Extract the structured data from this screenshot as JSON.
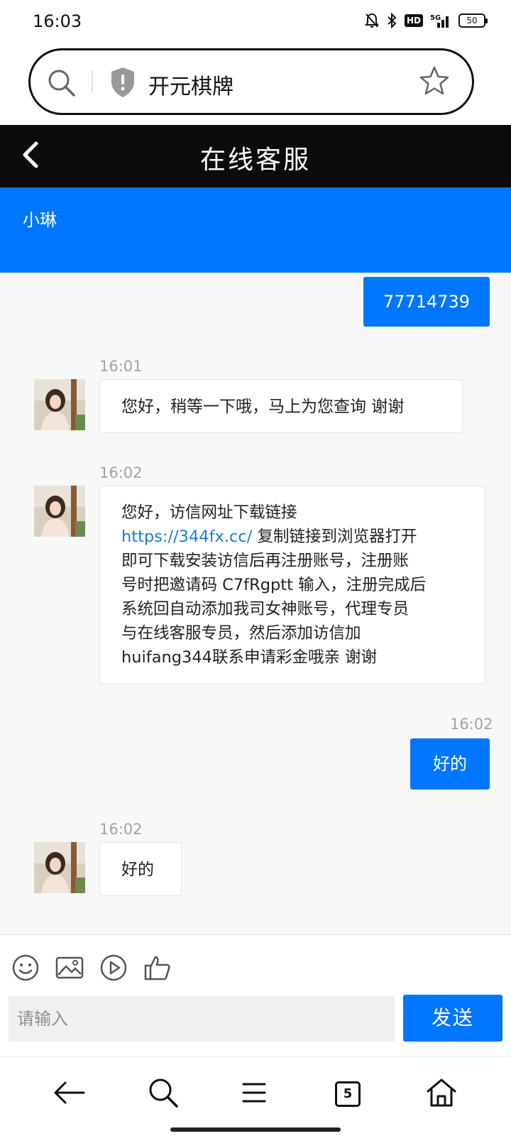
{
  "status_bar": {
    "time": "16:03",
    "network": "5G",
    "hd_label": "HD",
    "battery": "50",
    "icons": [
      "bell-off-icon",
      "bluetooth-icon",
      "hd-icon",
      "signal-icon",
      "battery-icon"
    ]
  },
  "address_bar": {
    "text": "开元棋牌",
    "icons": [
      "search-icon",
      "shield-warning-icon",
      "star-icon"
    ]
  },
  "header": {
    "title": "在线客服",
    "back_icon": "chevron-left-icon"
  },
  "agent": {
    "name": "小琳"
  },
  "colors": {
    "accent": "#0076ff",
    "title_bar": "#0c0c0c",
    "link": "#1f7ad6",
    "chat_bg": "#f8f8f8"
  },
  "messages": [
    {
      "from": "user",
      "text": "77714739"
    },
    {
      "from": "agent",
      "time": "16:01",
      "text": "您好，稍等一下哦，马上为您查询 谢谢"
    },
    {
      "from": "agent",
      "time": "16:02",
      "lines": [
        {
          "text": "您好，访信网址下载链接"
        },
        {
          "link": "https://344fx.cc/",
          "text": " 复制链接到浏览器打开"
        },
        {
          "text": "即可下载安装访信后再注册账号，注册账"
        },
        {
          "text": "号时把邀请码 C7fRgptt 输入，注册完成后"
        },
        {
          "text": "系统回自动添加我司女神账号，代理专员"
        },
        {
          "text": "与在线客服专员，然后添加访信加"
        },
        {
          "text": "huifang344联系申请彩金哦亲 谢谢"
        }
      ]
    },
    {
      "from": "user",
      "time": "16:02",
      "text": "好的"
    },
    {
      "from": "agent",
      "time": "16:02",
      "text": "好的"
    }
  ],
  "toolbar": {
    "icons": [
      "emoji-icon",
      "image-icon",
      "video-play-icon",
      "thumbs-up-icon"
    ]
  },
  "composer": {
    "placeholder": "请输入",
    "send_label": "发送"
  },
  "nav": {
    "tab_count": "5",
    "icons": [
      "back-arrow-icon",
      "search-icon",
      "menu-icon",
      "tabs-icon",
      "home-icon"
    ]
  }
}
